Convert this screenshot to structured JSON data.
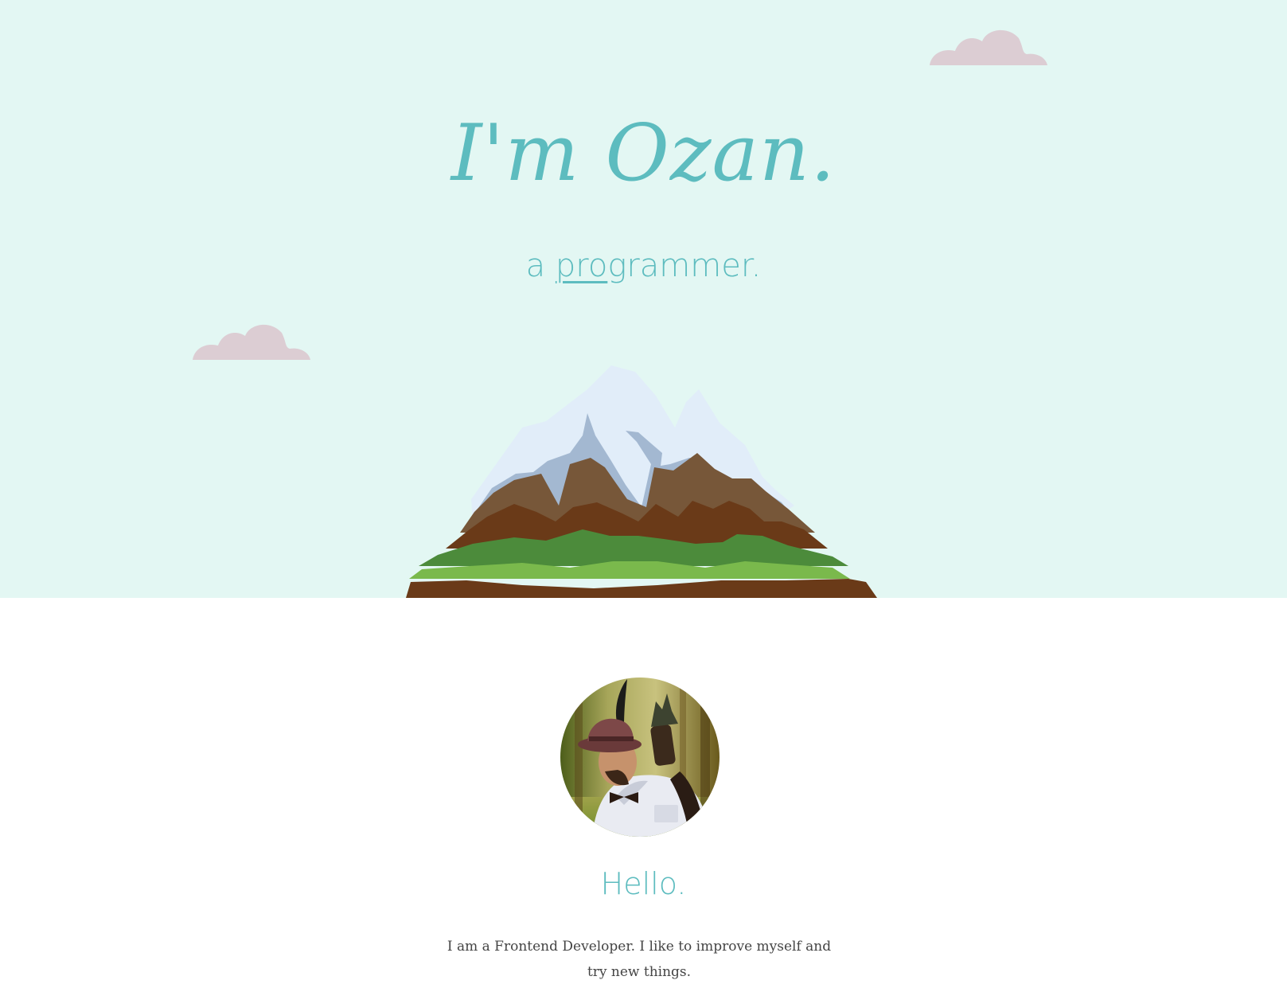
{
  "hero": {
    "title": "I'm Ozan.",
    "subtitle_prefix": "a",
    "subtitle_typed": "pro",
    "subtitle_rest": "grammer."
  },
  "about": {
    "heading": "Hello.",
    "text": "I am a Frontend Developer. I like to improve myself and try new things."
  },
  "colors": {
    "accent": "#5dbcbf",
    "sky": "#e3f7f3",
    "cloud": "#dccdd3",
    "body_text": "#444444"
  },
  "icons": {
    "cloud": "cloud-icon",
    "mountain": "mountain-illustration",
    "avatar": "profile-photo"
  }
}
